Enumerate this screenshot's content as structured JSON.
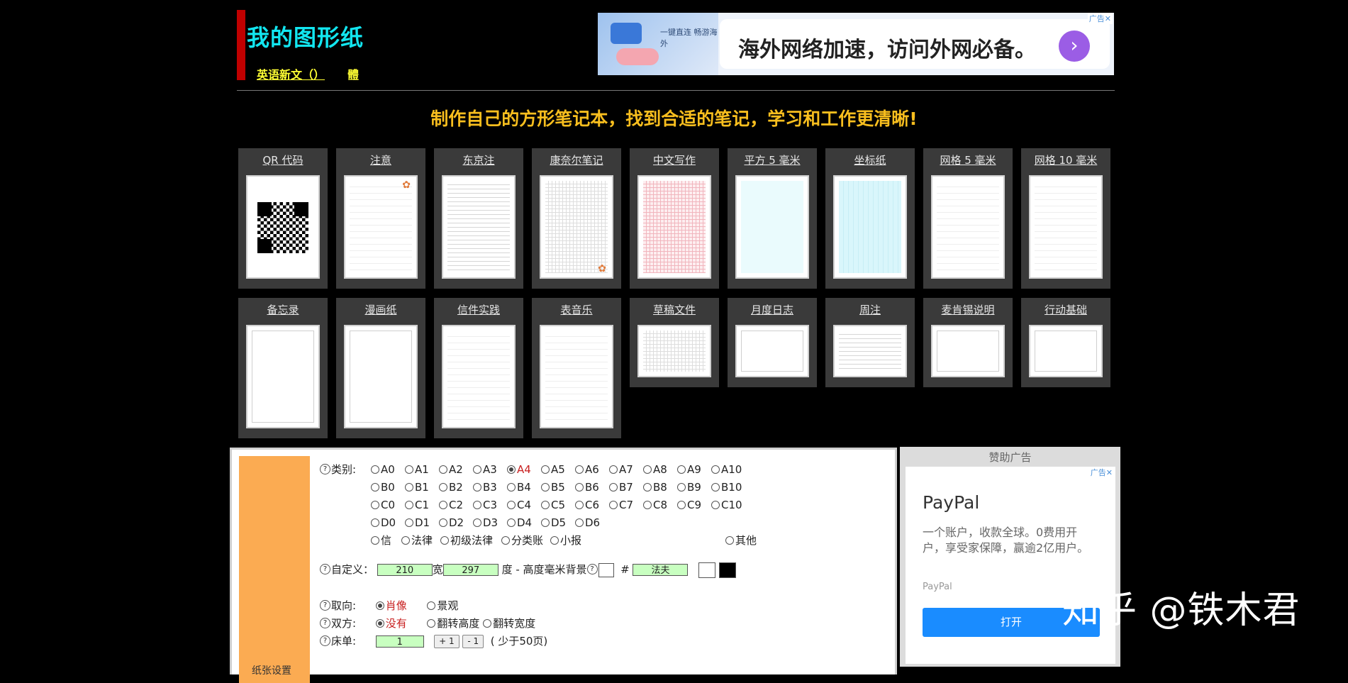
{
  "header": {
    "title": "我的图形纸",
    "lang_link": "英语新文（）",
    "trad_link": "體"
  },
  "top_ad": {
    "badge": "广告✕",
    "headline": "海外网络加速，访问外网必备。",
    "small_lines": "一键直连 畅游海外"
  },
  "tagline": "制作自己的方形笔记本，找到合适的笔记，学习和工作更清晰!",
  "templates_row1": [
    "QR 代码",
    "注意",
    "东京注",
    "康奈尔笔记",
    "中文写作",
    "平方 5 毫米",
    "坐标纸",
    "网格 5 毫米",
    "网格 10 毫米"
  ],
  "templates_row2": [
    "备忘录",
    "漫画纸",
    "信件实践",
    "表音乐",
    "草稿文件",
    "月度日志",
    "周注",
    "麦肯锡说明",
    "行动基础"
  ],
  "settings": {
    "side_label": "纸张设置",
    "category_label": "类别:",
    "series_a": [
      "A0",
      "A1",
      "A2",
      "A3",
      "A4",
      "A5",
      "A6",
      "A7",
      "A8",
      "A9",
      "A10"
    ],
    "series_b": [
      "B0",
      "B1",
      "B2",
      "B3",
      "B4",
      "B5",
      "B6",
      "B7",
      "B8",
      "B9",
      "B10"
    ],
    "series_c": [
      "C0",
      "C1",
      "C2",
      "C3",
      "C4",
      "C5",
      "C6",
      "C7",
      "C8",
      "C9",
      "C10"
    ],
    "series_d": [
      "D0",
      "D1",
      "D2",
      "D3",
      "D4",
      "D5",
      "D6"
    ],
    "series_other": [
      "信",
      "法律",
      "初级法律",
      "分类账",
      "小报"
    ],
    "other_label": "其他",
    "selected_size": "A4",
    "custom_label": "自定义：",
    "width_value": "210",
    "width_unit": "宽",
    "height_value": "297",
    "height_unit": "度 - 高度毫米背景",
    "hash": "#",
    "color_value": "法夫",
    "orientation_label": "取向:",
    "orientation_portrait": "肖像",
    "orientation_landscape": "景观",
    "duplex_label": "双方:",
    "duplex_none": "没有",
    "duplex_flip_height": "翻转高度",
    "duplex_flip_width": "翻转宽度",
    "bed_label": "床单:",
    "bed_value": "1",
    "plus_btn": "+ 1",
    "minus_btn": "- 1",
    "bed_hint": "( 少于50页)"
  },
  "sponsor": {
    "title": "赞助广告",
    "badge": "广告✕",
    "name": "PayPal",
    "desc": "一个账户，收款全球。0费用开户，享受家保障，赢逾2亿用户。",
    "small": "PayPal",
    "button": "打开"
  },
  "watermark": "知乎 @铁木君"
}
